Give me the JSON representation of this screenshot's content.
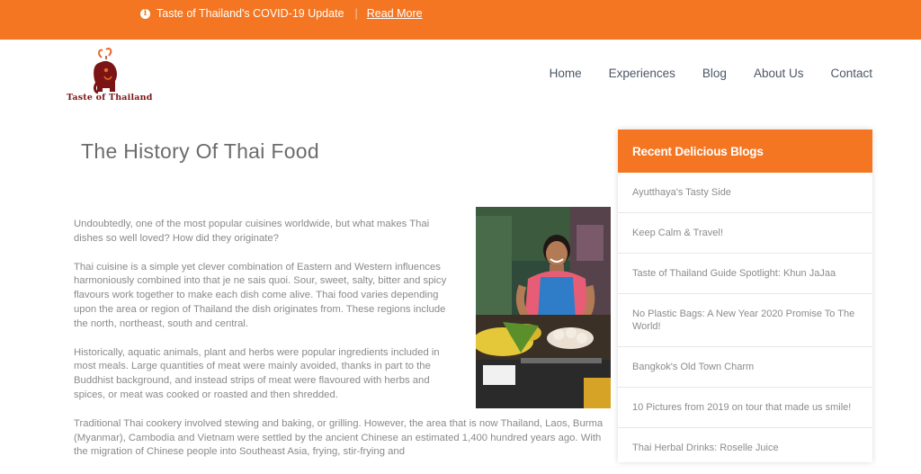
{
  "topbar": {
    "notice": "Taste of Thailand's COVID-19 Update",
    "separator": "|",
    "read_more": "Read More",
    "color": "#f47622"
  },
  "logo": {
    "text": "Taste of Thailand"
  },
  "nav": [
    "Home",
    "Experiences",
    "Blog",
    "About Us",
    "Contact"
  ],
  "article": {
    "title": "The History Of Thai Food",
    "paragraphs": [
      "Undoubtedly, one of the most popular cuisines worldwide, but what makes Thai dishes so well loved? How did they originate?",
      "Thai cuisine is a simple yet clever combination of Eastern and Western influences harmoniously combined into that je ne sais quoi. Sour, sweet, salty, bitter and spicy flavours work together to make each dish come alive. Thai food varies depending upon the area or region of Thailand the dish originates from. These regions include the north, northeast, south and central.",
      "Historically, aquatic animals, plant and herbs were popular ingredients included in most meals. Large quantities of meat were mainly avoided, thanks in part to the Buddhist background, and instead strips of meat were flavoured with herbs and spices, or meat was cooked or roasted and then shredded.",
      "Traditional Thai cookery involved stewing and baking, or grilling. However, the area that is now Thailand, Laos, Burma (Myanmar), Cambodia and Vietnam were settled by the ancient Chinese an estimated 1,400 hundred years ago. With the migration of Chinese people into Southeast Asia, frying, stir-frying and"
    ]
  },
  "sidebar": {
    "title": "Recent Delicious Blogs",
    "items": [
      "Ayutthaya's Tasty Side",
      "Keep Calm & Travel!",
      "Taste of Thailand Guide Spotlight: Khun JaJaa",
      "No Plastic Bags: A New Year 2020 Promise To The World!",
      "Bangkok's Old Town Charm",
      "10 Pictures from 2019 on tour that made us smile!",
      "Thai Herbal Drinks: Roselle Juice"
    ]
  }
}
